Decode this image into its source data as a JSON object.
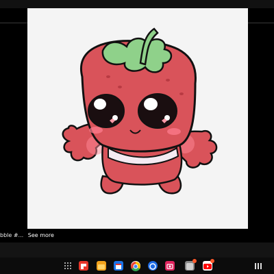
{
  "caption": {
    "text": "bble #...",
    "see_more": "See more"
  },
  "taskbar": {
    "apps": [
      {
        "icon": "all-apps-icon"
      },
      {
        "icon": "flipboard-icon",
        "color": "#e8362a"
      },
      {
        "icon": "files-icon",
        "color": "#f2a21c"
      },
      {
        "icon": "calendar-icon",
        "color": "#1a73e8"
      },
      {
        "icon": "chrome-icon",
        "color": "#34a853"
      },
      {
        "icon": "browser-icon",
        "color": "#1e6be3"
      },
      {
        "icon": "gallery-icon",
        "color": "#e0245e"
      },
      {
        "icon": "game-icon",
        "color": "#8a8a8a"
      },
      {
        "icon": "youtube-icon",
        "color": "#ff0000"
      },
      {
        "icon": "recent-apps-icon"
      }
    ]
  },
  "colors": {
    "strawberry": "#d9535a",
    "leaf": "#8fd18a",
    "background": "#000000"
  }
}
